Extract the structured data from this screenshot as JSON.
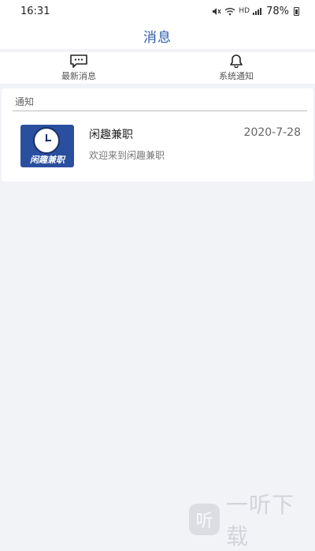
{
  "status_bar": {
    "time": "16:31",
    "network_label": "HD",
    "battery": "78%"
  },
  "nav": {
    "title": "消息"
  },
  "tabs": [
    {
      "label": "最新消息",
      "icon": "chat-bubble-icon"
    },
    {
      "label": "系统通知",
      "icon": "bell-icon"
    }
  ],
  "section": {
    "label": "通知"
  },
  "messages": [
    {
      "title": "闲趣兼职",
      "date": "2020-7-28",
      "preview": "欢迎来到闲趣兼职",
      "icon_text": "闲趣兼职"
    }
  ],
  "watermark": {
    "badge": "听",
    "text": "一听下载"
  },
  "colors": {
    "accent": "#2d5ba8",
    "app_icon_bg": "#2a4f9e",
    "page_bg": "#f2f3f7"
  }
}
